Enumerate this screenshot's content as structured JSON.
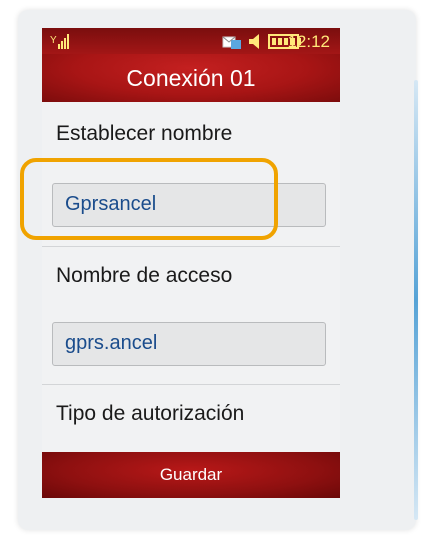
{
  "status_bar": {
    "time": "12:12",
    "icons": [
      "signal-icon",
      "sms-icon",
      "speaker-icon",
      "battery-icon"
    ]
  },
  "header": {
    "title": "Conexión 01"
  },
  "form": {
    "name_label": "Establecer nombre",
    "name_value": "Gprsancel",
    "access_label": "Nombre de acceso",
    "access_value": "gprs.ancel",
    "auth_label": "Tipo de autorización"
  },
  "footer": {
    "save_label": "Guardar"
  },
  "colors": {
    "header_red": "#a81515",
    "status_text": "#ffe97a",
    "field_text": "#1a4c8c",
    "highlight": "#f0a300"
  }
}
